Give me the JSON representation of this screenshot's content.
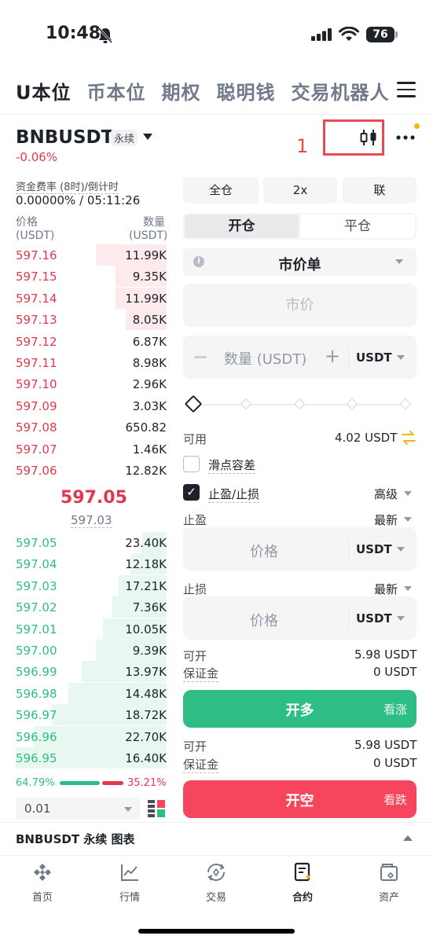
{
  "status": {
    "time": "10:48",
    "battery": "76"
  },
  "top_tabs": [
    "U本位",
    "币本位",
    "期权",
    "聪明钱",
    "交易机器人"
  ],
  "symbol": {
    "name": "BNBUSDT",
    "badge": "永续",
    "change": "-0.06%"
  },
  "annotation": {
    "label": "1"
  },
  "funding": {
    "label": "资金费率 (8时)/倒计时",
    "value": "0.00000% / 05:11:26"
  },
  "orderbook": {
    "price_header": "价格",
    "price_unit": "(USDT)",
    "qty_header": "数量",
    "qty_unit": "(USDT)",
    "asks": [
      {
        "p": "597.16",
        "q": "11.99K",
        "depth": 0.47
      },
      {
        "p": "597.15",
        "q": "9.35K",
        "depth": 0.34
      },
      {
        "p": "597.14",
        "q": "11.99K",
        "depth": 0.34
      },
      {
        "p": "597.13",
        "q": "8.05K",
        "depth": 0.27
      },
      {
        "p": "597.12",
        "q": "6.87K",
        "depth": 0
      },
      {
        "p": "597.11",
        "q": "8.98K",
        "depth": 0
      },
      {
        "p": "597.10",
        "q": "2.96K",
        "depth": 0
      },
      {
        "p": "597.09",
        "q": "3.03K",
        "depth": 0
      },
      {
        "p": "597.08",
        "q": "650.82",
        "depth": 0
      },
      {
        "p": "597.07",
        "q": "1.46K",
        "depth": 0
      },
      {
        "p": "597.06",
        "q": "12.82K",
        "depth": 0
      }
    ],
    "mid_price": "597.05",
    "mark_price": "597.03",
    "bids": [
      {
        "p": "597.05",
        "q": "23.40K",
        "depth": 0.16
      },
      {
        "p": "597.04",
        "q": "12.18K",
        "depth": 0.24
      },
      {
        "p": "597.03",
        "q": "17.21K",
        "depth": 0.32
      },
      {
        "p": "597.02",
        "q": "7.36K",
        "depth": 0.36
      },
      {
        "p": "597.01",
        "q": "10.05K",
        "depth": 0.42
      },
      {
        "p": "597.00",
        "q": "9.39K",
        "depth": 0.47
      },
      {
        "p": "596.99",
        "q": "13.97K",
        "depth": 0.56
      },
      {
        "p": "596.98",
        "q": "14.48K",
        "depth": 0.65
      },
      {
        "p": "596.97",
        "q": "18.72K",
        "depth": 0.76
      },
      {
        "p": "596.96",
        "q": "22.70K",
        "depth": 0.88
      },
      {
        "p": "596.95",
        "q": "16.40K",
        "depth": 1.0
      }
    ],
    "buy_ratio": "64.79%",
    "sell_ratio": "35.21%",
    "precision": "0.01"
  },
  "trade": {
    "margin_mode": "全仓",
    "leverage": "2x",
    "asset_mode": "联",
    "open_label": "开仓",
    "close_label": "平仓",
    "order_type": "市价单",
    "price_placeholder": "市价",
    "qty_placeholder": "数量 (USDT)",
    "qty_unit": "USDT",
    "available_label": "可用",
    "available_value": "4.02 USDT",
    "slippage_label": "滑点容差",
    "tpsl_label": "止盈/止损",
    "advanced_label": "高级",
    "tp_label": "止盈",
    "tp_trigger": "最新",
    "tp_placeholder": "价格",
    "tp_unit": "USDT",
    "sl_label": "止损",
    "sl_trigger": "最新",
    "sl_placeholder": "价格",
    "sl_unit": "USDT",
    "long": {
      "max_label": "可开",
      "max_value": "5.98 USDT",
      "margin_label": "保证金",
      "margin_value": "0 USDT",
      "button": "开多",
      "sub": "看涨"
    },
    "short": {
      "max_label": "可开",
      "max_value": "5.98 USDT",
      "margin_label": "保证金",
      "margin_value": "0 USDT",
      "button": "开空",
      "sub": "看跌"
    }
  },
  "chart_bar": {
    "title": "BNBUSDT 永续 图表"
  },
  "nav": [
    {
      "label": "首页",
      "icon": "home-icon"
    },
    {
      "label": "行情",
      "icon": "markets-icon"
    },
    {
      "label": "交易",
      "icon": "trade-icon"
    },
    {
      "label": "合约",
      "icon": "futures-icon"
    },
    {
      "label": "资产",
      "icon": "wallet-icon"
    }
  ]
}
